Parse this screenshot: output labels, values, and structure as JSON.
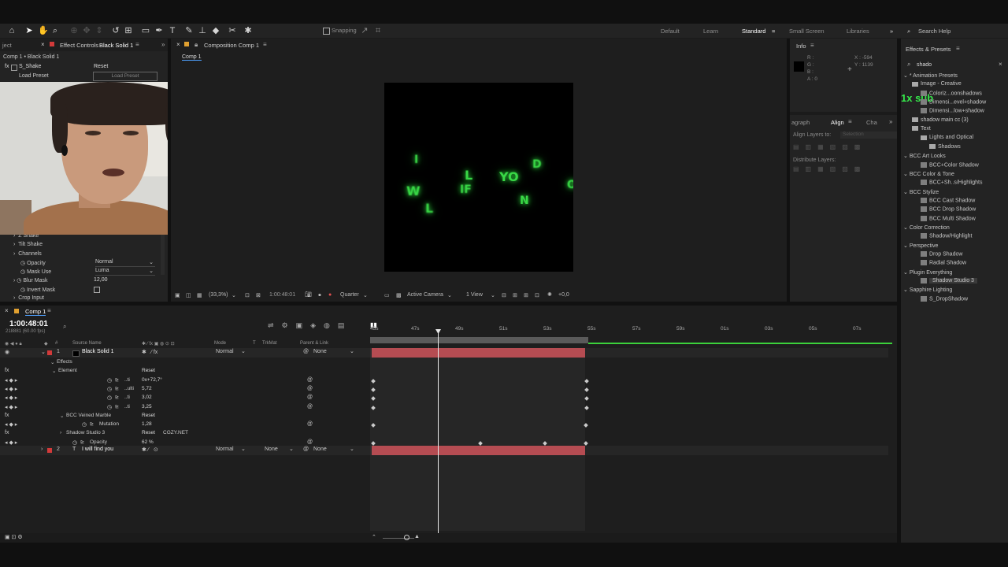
{
  "toolbar": {
    "snapping_label": "Snapping",
    "workspaces": [
      "Default",
      "Learn",
      "Standard",
      "Small Screen",
      "Libraries"
    ],
    "active_workspace": "Standard",
    "search_help": "Search Help"
  },
  "left_panel": {
    "project_tab": "ject",
    "effect_controls_tab": "Effect Controls",
    "effect_controls_layer": "Black Solid 1",
    "breadcrumb": "Comp 1 • Black Solid 1",
    "effect_name": "S_Shake",
    "reset_label": "Reset",
    "load_preset_label": "Load Preset",
    "load_preset_button": "Load Preset",
    "props": [
      {
        "name": "Z Shake",
        "value": ""
      },
      {
        "name": "Tilt Shake",
        "value": ""
      },
      {
        "name": "Channels",
        "value": ""
      },
      {
        "name": "Opacity",
        "value": "Normal"
      },
      {
        "name": "Mask Use",
        "value": "Luma"
      },
      {
        "name": "Blur Mask",
        "value": "12,00"
      },
      {
        "name": "Invert Mask",
        "value": ""
      },
      {
        "name": "Crop Input",
        "value": ""
      }
    ]
  },
  "composition": {
    "tab_label": "Composition Comp 1",
    "subtab": "Comp 1",
    "zoom": "(33,3%)",
    "timecode": "1:00:48:01",
    "resolution": "Quarter",
    "camera": "Active Camera",
    "views": "1 View",
    "exposure": "+0,0",
    "letters": [
      "I",
      "L",
      "D",
      "W",
      "IF",
      "YO",
      "L",
      "N"
    ]
  },
  "info": {
    "tab": "Info",
    "r": "R :",
    "g": "G :",
    "b": "B :",
    "a": "A :  0",
    "x": "X : -594",
    "y": "Y : 1139"
  },
  "align": {
    "tabs": [
      "agraph",
      "Align",
      "Cha"
    ],
    "align_to_label": "Align Layers to:",
    "align_to_value": "Selection",
    "distribute_label": "Distribute Layers:"
  },
  "effects_presets": {
    "title": "Effects & Presets",
    "search_value": "shado",
    "overlay": "1x sub",
    "items": [
      {
        "label": "* Animation Presets",
        "indent": 0,
        "type": "root"
      },
      {
        "label": "Image - Creative",
        "indent": 1,
        "type": "folder"
      },
      {
        "label": "Coloriz...oonshadows",
        "indent": 2,
        "type": "fx"
      },
      {
        "label": "Dimensi...evel+shadow",
        "indent": 2,
        "type": "fx"
      },
      {
        "label": "Dimensi...low+shadow",
        "indent": 2,
        "type": "fx"
      },
      {
        "label": "shadow main cc (3)",
        "indent": 1,
        "type": "folder"
      },
      {
        "label": "Text",
        "indent": 1,
        "type": "folder"
      },
      {
        "label": "Lights and Optical",
        "indent": 2,
        "type": "folder"
      },
      {
        "label": "Shadows",
        "indent": 3,
        "type": "folder"
      },
      {
        "label": "BCC Art Looks",
        "indent": 0,
        "type": "cat"
      },
      {
        "label": "BCC+Color Shadow",
        "indent": 2,
        "type": "fx"
      },
      {
        "label": "BCC Color & Tone",
        "indent": 0,
        "type": "cat"
      },
      {
        "label": "BCC+Sh..s/Highlights",
        "indent": 2,
        "type": "fx"
      },
      {
        "label": "BCC Stylize",
        "indent": 0,
        "type": "cat"
      },
      {
        "label": "BCC Cast Shadow",
        "indent": 2,
        "type": "fx"
      },
      {
        "label": "BCC Drop Shadow",
        "indent": 2,
        "type": "fx"
      },
      {
        "label": "BCC Multi Shadow",
        "indent": 2,
        "type": "fx"
      },
      {
        "label": "Color Correction",
        "indent": 0,
        "type": "cat"
      },
      {
        "label": "Shadow/Highlight",
        "indent": 2,
        "type": "fx"
      },
      {
        "label": "Perspective",
        "indent": 0,
        "type": "cat"
      },
      {
        "label": "Drop Shadow",
        "indent": 2,
        "type": "fx"
      },
      {
        "label": "Radial Shadow",
        "indent": 2,
        "type": "fx"
      },
      {
        "label": "Plugin Everything",
        "indent": 0,
        "type": "cat"
      },
      {
        "label": "Shadow Studio 3",
        "indent": 2,
        "type": "fx-selected"
      },
      {
        "label": "Sapphire Lighting",
        "indent": 0,
        "type": "cat"
      },
      {
        "label": "S_DropShadow",
        "indent": 2,
        "type": "fx"
      }
    ]
  },
  "timeline": {
    "tab": "Comp 1",
    "timecode": "1:00:48:01",
    "frame_info": "218881 (60.00 fps)",
    "headers": {
      "source_name": "Source Name",
      "mode": "Mode",
      "t": "T",
      "trkmat": "TrkMat",
      "parent": "Parent & Link"
    },
    "ruler": [
      "45s",
      "47s",
      "49s",
      "51s",
      "53s",
      "55s",
      "57s",
      "59s",
      "01s",
      "03s",
      "05s",
      "07s"
    ],
    "layers": [
      {
        "num": "1",
        "name": "Black Solid 1",
        "mode": "Normal",
        "trkmat": "",
        "parent": "None"
      },
      {
        "num": "2",
        "name": "I will find you",
        "mode": "Normal",
        "trkmat": "None",
        "parent": "None"
      }
    ],
    "rows": [
      {
        "label": "Effects",
        "value": ""
      },
      {
        "label": "Element",
        "value": "Reset"
      },
      {
        "label": "..ti",
        "value": "0x+72,7°"
      },
      {
        "label": "..ulti",
        "value": "5,72"
      },
      {
        "label": "..ti",
        "value": "3,02"
      },
      {
        "label": "..ti",
        "value": "3,25"
      },
      {
        "label": "BCC Veined Marble",
        "value": "Reset"
      },
      {
        "label": "Mutation",
        "value": "1,28"
      },
      {
        "label": "Shadow Studio 3",
        "value": "Reset"
      },
      {
        "label": "Opacity",
        "value": "62 %"
      }
    ],
    "shadow_studio_extra": "CGZY.NET"
  }
}
